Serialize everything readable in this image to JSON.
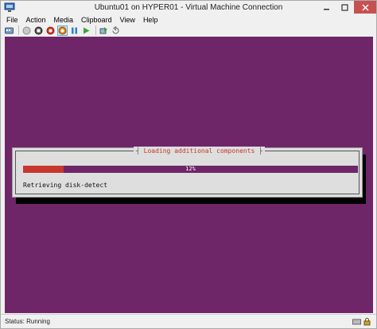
{
  "window": {
    "title": "Ubuntu01 on HYPER01 - Virtual Machine Connection"
  },
  "menu": {
    "items": [
      "File",
      "Action",
      "Media",
      "Clipboard",
      "View",
      "Help"
    ]
  },
  "toolbar": {
    "buttons": [
      {
        "name": "ctrl-alt-del-icon"
      },
      {
        "name": "start-icon"
      },
      {
        "name": "turn-off-icon"
      },
      {
        "name": "shutdown-icon"
      },
      {
        "name": "save-state-icon",
        "active": true
      },
      {
        "name": "pause-icon"
      },
      {
        "name": "resume-icon"
      },
      {
        "name": "checkpoint-icon"
      },
      {
        "name": "revert-icon"
      }
    ]
  },
  "installer": {
    "dialog_title": "Loading additional components",
    "progress_percent": 12,
    "progress_label": "12%",
    "status_message": "Retrieving disk-detect"
  },
  "statusbar": {
    "text": "Status: Running"
  },
  "colors": {
    "vm_background": "#6e2669",
    "progress_fill": "#c8372e",
    "dialog_title": "#c0392b"
  }
}
